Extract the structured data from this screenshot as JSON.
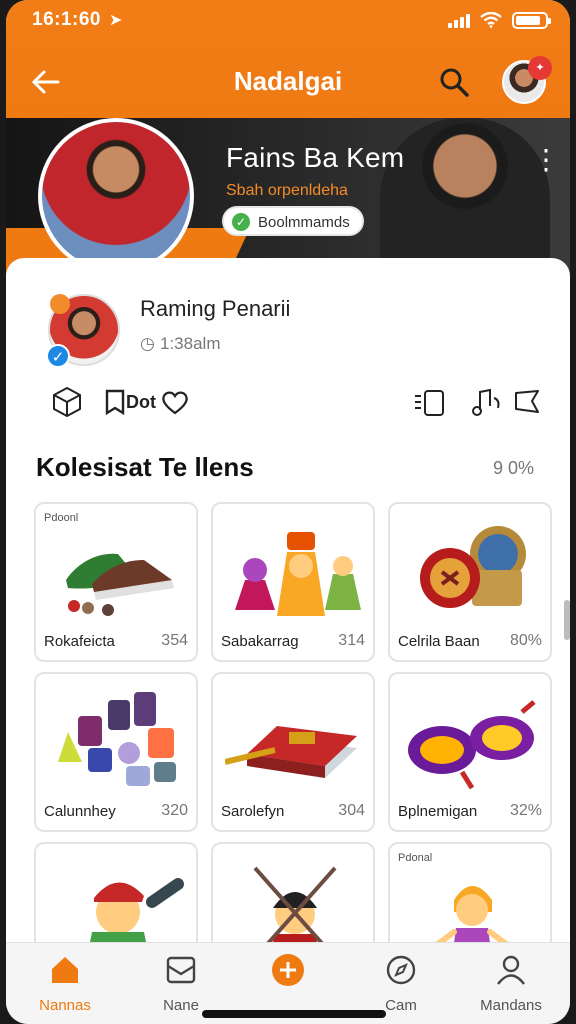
{
  "status": {
    "time": "16:1:60"
  },
  "header": {
    "title": "Nadalgai"
  },
  "banner": {
    "name": "Fains Ba Kem",
    "subtitle": "Sbah orpenldeha",
    "chip": "Boolmmamds"
  },
  "profile": {
    "name": "Raming Penarii",
    "time": "1:38alm"
  },
  "actions": {
    "label_a": "Dot"
  },
  "section": {
    "title": "Kolesisat Te llens",
    "percent": "9 0%"
  },
  "items": [
    {
      "tag": "Pdoonl",
      "name": "Rokafeicta",
      "value": "354",
      "icon": "sneakers-icon"
    },
    {
      "tag": "",
      "name": "Sabakarrag",
      "value": "314",
      "icon": "figures-icon"
    },
    {
      "tag": "",
      "name": "Celrila Baan",
      "value": "80%",
      "icon": "medallion-icon"
    },
    {
      "tag": "",
      "name": "Calunnhey",
      "value": "320",
      "icon": "gems-icon"
    },
    {
      "tag": "",
      "name": "Sarolefyn",
      "value": "304",
      "icon": "book-icon"
    },
    {
      "tag": "",
      "name": "Bplnemigan",
      "value": "32%",
      "icon": "tokens-icon"
    },
    {
      "tag": "",
      "name": "",
      "value": "",
      "icon": "warrior-icon"
    },
    {
      "tag": "",
      "name": "",
      "value": "",
      "icon": "samurai-icon"
    },
    {
      "tag": "Pdonal",
      "name": "",
      "value": "",
      "icon": "princess-icon"
    }
  ],
  "nav": [
    {
      "label": "Nannas",
      "icon": "home-icon"
    },
    {
      "label": "Nane",
      "icon": "inbox-icon"
    },
    {
      "label": "",
      "icon": "add-icon"
    },
    {
      "label": "Cam",
      "icon": "compass-icon"
    },
    {
      "label": "Mandans",
      "icon": "profile-icon"
    }
  ],
  "colors": {
    "accent": "#ef7a12",
    "verified": "#1e88e5",
    "success": "#46b04a"
  }
}
